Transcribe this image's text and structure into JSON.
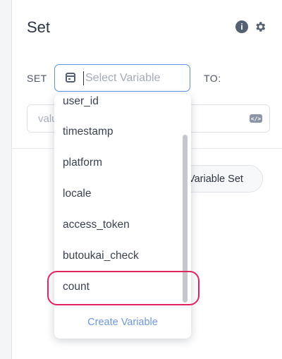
{
  "header": {
    "title": "Set",
    "icons": [
      "info-icon",
      "gear-icon"
    ]
  },
  "form": {
    "set_label": "SET",
    "to_label": "TO:",
    "select_placeholder": "Select Variable",
    "select_value": "",
    "value_placeholder": "value",
    "value_icon": "code-icon"
  },
  "button": {
    "label": "Variable Set"
  },
  "dropdown": {
    "items": [
      "user_id",
      "timestamp",
      "platform",
      "locale",
      "access_token",
      "butoukai_check",
      "count"
    ],
    "highlighted_item": "count",
    "footer_link": "Create Variable"
  },
  "colors": {
    "accent": "#5a94e6",
    "link": "#6e97e0",
    "highlight_outline": "#e0245e",
    "scrollbar": "#c4c7cc"
  }
}
